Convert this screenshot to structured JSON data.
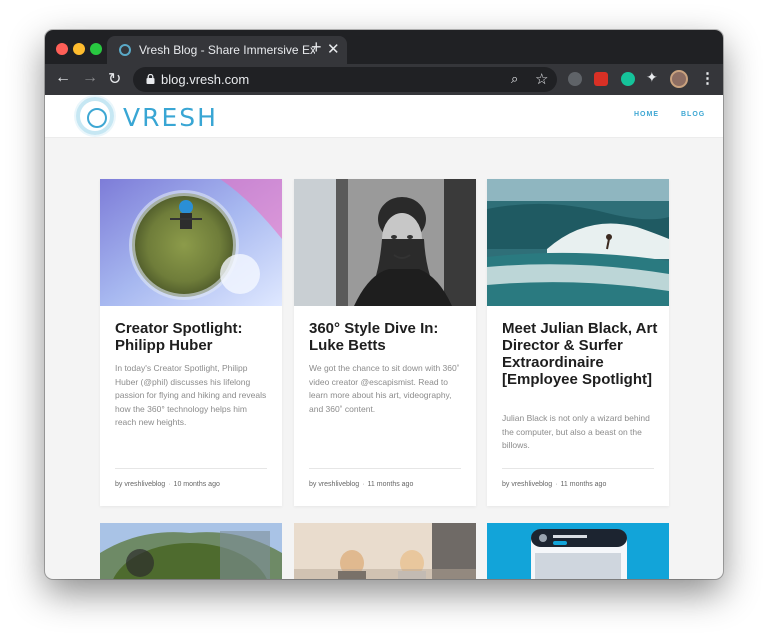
{
  "browser": {
    "tab_title": "Vresh Blog - Share Immersive Experiences",
    "tab_close": "✕",
    "new_tab": "+",
    "url": "blog.vresh.com"
  },
  "site": {
    "logo_text": "VRESH",
    "nav": [
      "HOME",
      "BLOG"
    ]
  },
  "posts": [
    {
      "title": "Creator Spotlight: Philipp Huber",
      "excerpt": "In today's Creator Spotlight, Philipp Huber (@phil) discusses his lifelong passion for flying and hiking and reveals how the 360° technology helps him reach new heights.",
      "author": "by vreshliveblog",
      "time": "10 months ago"
    },
    {
      "title": "360° Style Dive In: Luke Betts",
      "excerpt": "We got the chance to sit down with 360˚ video creator @escapismist. Read to learn more about his art, videography, and 360˚ content.",
      "author": "by vreshliveblog",
      "time": "11 months ago"
    },
    {
      "title": "Meet Julian Black, Art Director & Surfer Extraordinaire [Employee Spotlight]",
      "excerpt": "Julian Black is not only a wizard behind the computer, but also a beast on the billows.",
      "author": "by vreshliveblog",
      "time": "11 months ago"
    }
  ],
  "colors": {
    "accent": "#3ea7d3",
    "chrome_dark": "#202124",
    "chrome_toolbar": "#35363a",
    "page_bg": "#f4f4f4"
  },
  "icons": [
    "back-arrow-icon",
    "forward-arrow-icon",
    "reload-icon",
    "lock-icon",
    "zoom-icon",
    "bookmark-star-icon",
    "extensions-puzzle-icon",
    "kebab-menu-icon"
  ]
}
